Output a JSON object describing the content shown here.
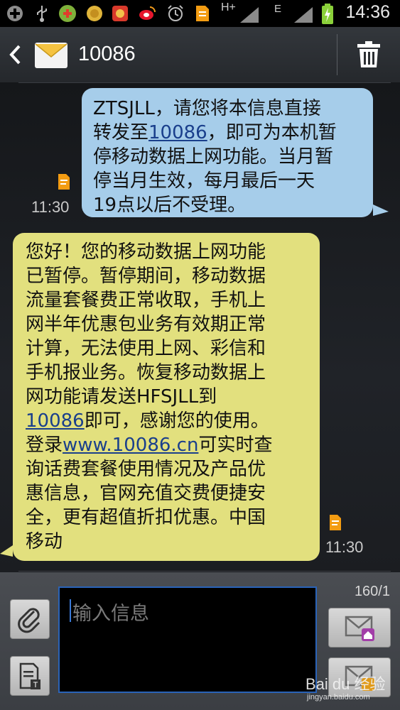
{
  "status_bar": {
    "time": "14:36",
    "network": "H+",
    "network2": "E"
  },
  "header": {
    "title": "10086"
  },
  "messages": [
    {
      "direction": "outgoing",
      "parts": [
        {
          "text": "ZTSJLL，请您将本信息直接\n转发至"
        },
        {
          "text": "10086",
          "link": true
        },
        {
          "text": "，即可为本机暂\n停移动数据上网功能。当月暂\n停当月生效，每月最后一天\n19点以后不受理。"
        }
      ],
      "time": "11:30"
    },
    {
      "direction": "incoming",
      "parts": [
        {
          "text": "您好！您的移动数据上网功能\n已暂停。暂停期间，移动数据\n流量套餐费正常收取，手机上\n网半年优惠包业务有效期正常\n计算，无法使用上网、彩信和\n手机报业务。恢复移动数据上\n网功能请发送HFSJLL到\n"
        },
        {
          "text": "10086",
          "link": true
        },
        {
          "text": "即可，感谢您的使用。\n登录"
        },
        {
          "text": "www.10086.cn",
          "link": true
        },
        {
          "text": "可实时查\n询话费套餐使用情况及产品优\n惠信息，官网充值交费便捷安\n全，更有超值折扣优惠。中国\n移动"
        }
      ],
      "time": "11:30"
    }
  ],
  "composer": {
    "placeholder": "输入信息",
    "counter": "160/1"
  },
  "watermark": {
    "text": "Bai du 经验",
    "url": "jingyan.baidu.com"
  },
  "colors": {
    "outgoing_bubble": "#a6cdea",
    "incoming_bubble": "#e2e07e",
    "link": "#1a3f8c"
  }
}
